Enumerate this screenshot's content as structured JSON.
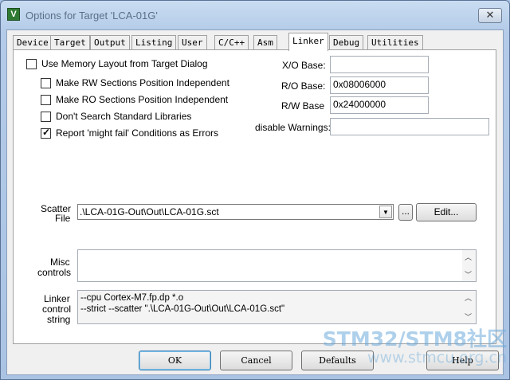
{
  "window": {
    "title": "Options for Target 'LCA-01G'",
    "icon_glyph": "V",
    "close_label": "✕"
  },
  "tabs": [
    {
      "label": "Device",
      "active": false
    },
    {
      "label": "Target",
      "active": false
    },
    {
      "label": "Output",
      "active": false
    },
    {
      "label": "Listing",
      "active": false
    },
    {
      "label": "User",
      "active": false
    },
    {
      "label": "C/C++",
      "active": false
    },
    {
      "label": "Asm",
      "active": false
    },
    {
      "label": "Linker",
      "active": true
    },
    {
      "label": "Debug",
      "active": false
    },
    {
      "label": "Utilities",
      "active": false
    }
  ],
  "options": {
    "use_memory_layout": {
      "label": "Use Memory Layout from Target Dialog",
      "checked": false
    },
    "rw_independent": {
      "label": "Make RW Sections Position Independent",
      "checked": false
    },
    "ro_independent": {
      "label": "Make RO Sections Position Independent",
      "checked": false
    },
    "dont_search_libs": {
      "label": "Don't Search Standard Libraries",
      "checked": false
    },
    "might_fail_errors": {
      "label": "Report 'might fail' Conditions as Errors",
      "checked": true
    }
  },
  "bases": {
    "xo_label": "X/O Base:",
    "xo_value": "",
    "ro_label": "R/O Base:",
    "ro_value": "0x08006000",
    "rw_label": "R/W Base",
    "rw_value": "0x24000000",
    "warnings_label": "disable Warnings:",
    "warnings_value": ""
  },
  "scatter": {
    "label_line1": "Scatter",
    "label_line2": "File",
    "value": ".\\LCA-01G-Out\\Out\\LCA-01G.sct",
    "browse_label": "...",
    "edit_label": "Edit..."
  },
  "misc": {
    "label_line1": "Misc",
    "label_line2": "controls",
    "value": ""
  },
  "linker_string": {
    "label_line1": "Linker",
    "label_line2": "control",
    "label_line3": "string",
    "line1": "--cpu Cortex-M7.fp.dp *.o",
    "line2": "--strict --scatter \".\\LCA-01G-Out\\Out\\LCA-01G.sct\""
  },
  "buttons": {
    "ok": "OK",
    "cancel": "Cancel",
    "defaults": "Defaults",
    "help": "Help"
  },
  "watermark": {
    "line1": "STM32/STM8社区",
    "line2": "www.stmcu.org.cn"
  },
  "colors": {
    "titlebar": "#b9d1ea",
    "dialog_bg": "#f0f0f0",
    "tab_body": "#ffffff",
    "watermark": "#6caada"
  }
}
